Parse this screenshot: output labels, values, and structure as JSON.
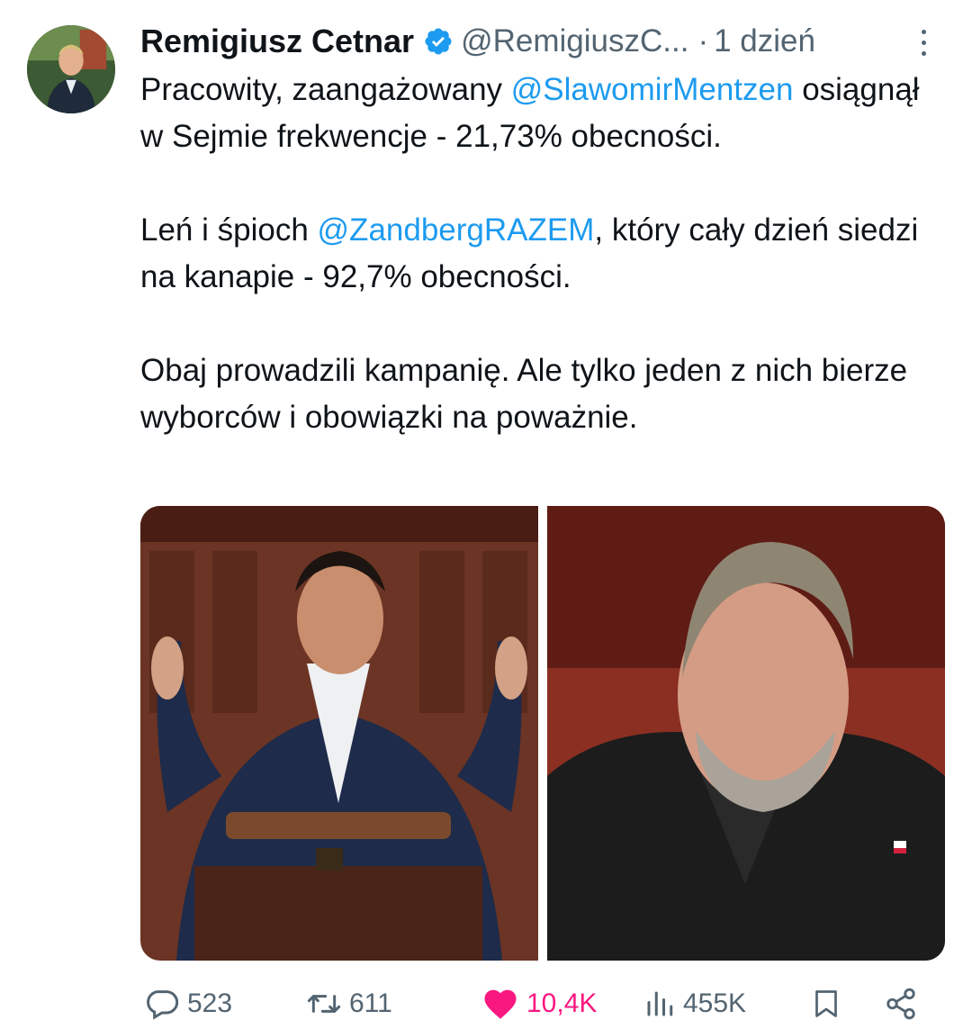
{
  "tweet": {
    "author": {
      "name": "Remigiusz Cetnar",
      "handle": "@RemigiuszC...",
      "verified": true,
      "avatar_icon": "profile-photo"
    },
    "separator": "·",
    "time": "1 dzień",
    "paragraphs": [
      [
        {
          "text": "Pracowity, zaangażowany ",
          "type": "text"
        },
        {
          "text": "@SlawomirMentzen",
          "type": "mention"
        },
        {
          "text": " osiągnął w Sejmie frekwencje - 21,73% obecności.",
          "type": "text"
        }
      ],
      [
        {
          "text": "Leń i śpioch ",
          "type": "text"
        },
        {
          "text": "@ZandbergRAZEM",
          "type": "mention"
        },
        {
          "text": ", który cały dzień siedzi na kanapie - 92,7% obecności.",
          "type": "text"
        }
      ],
      [
        {
          "text": "Obaj prowadzili kampanię. Ale tylko jeden z nich bierze wyborców i obowiązki na poważnie.",
          "type": "text"
        }
      ]
    ],
    "media": [
      {
        "icon": "photo-speaker-at-podium"
      },
      {
        "icon": "photo-man-with-beard"
      }
    ],
    "actions": {
      "replies": "523",
      "reposts": "611",
      "likes": "10,4K",
      "views": "455K"
    }
  },
  "colors": {
    "mention": "#1d9bf0",
    "secondary_text": "#536471",
    "like": "#f91880",
    "verified": "#1d9bf0"
  }
}
